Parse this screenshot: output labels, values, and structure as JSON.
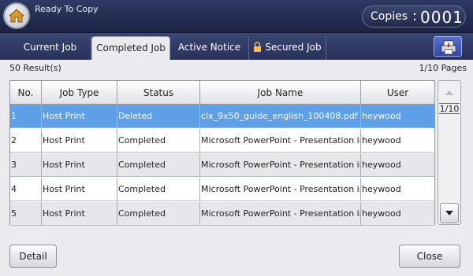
{
  "header": {
    "status": "Ready To Copy",
    "copies_label": "Copies",
    "copies_colon": ":",
    "copies_value": "0001"
  },
  "tabs": [
    {
      "label": "Current Job"
    },
    {
      "label": "Completed Job"
    },
    {
      "label": "Active Notice"
    },
    {
      "label": "Secured Job"
    }
  ],
  "summary": {
    "results": "50 Result(s)",
    "pages": "1/10 Pages"
  },
  "table": {
    "columns": [
      "No.",
      "Job Type",
      "Status",
      "Job Name",
      "User"
    ],
    "rows": [
      [
        "1",
        "Host Print",
        "Deleted",
        "clx_9x50_guide_english_100408.pdf",
        "heywood"
      ],
      [
        "2",
        "Host Print",
        "Completed",
        "Microsoft PowerPoint - Presentation in A",
        "heywood"
      ],
      [
        "3",
        "Host Print",
        "Completed",
        "Microsoft PowerPoint - Presentation in A",
        "heywood"
      ],
      [
        "4",
        "Host Print",
        "Completed",
        "Microsoft PowerPoint - Presentation in A",
        "heywood"
      ],
      [
        "5",
        "Host Print",
        "Completed",
        "Microsoft PowerPoint - Presentation in A",
        "heywood"
      ]
    ]
  },
  "scroll": {
    "page_indicator": "1/10"
  },
  "footer": {
    "detail_label": "Detail",
    "close_label": "Close"
  },
  "colors": {
    "header_bg": "#1b2444",
    "selected_row": "#5f9fe8"
  },
  "icons": {
    "home": "home-icon",
    "lock": "lock-icon",
    "job_status": "job-status-icon",
    "up": "up-arrow-icon",
    "down": "down-arrow-icon"
  }
}
